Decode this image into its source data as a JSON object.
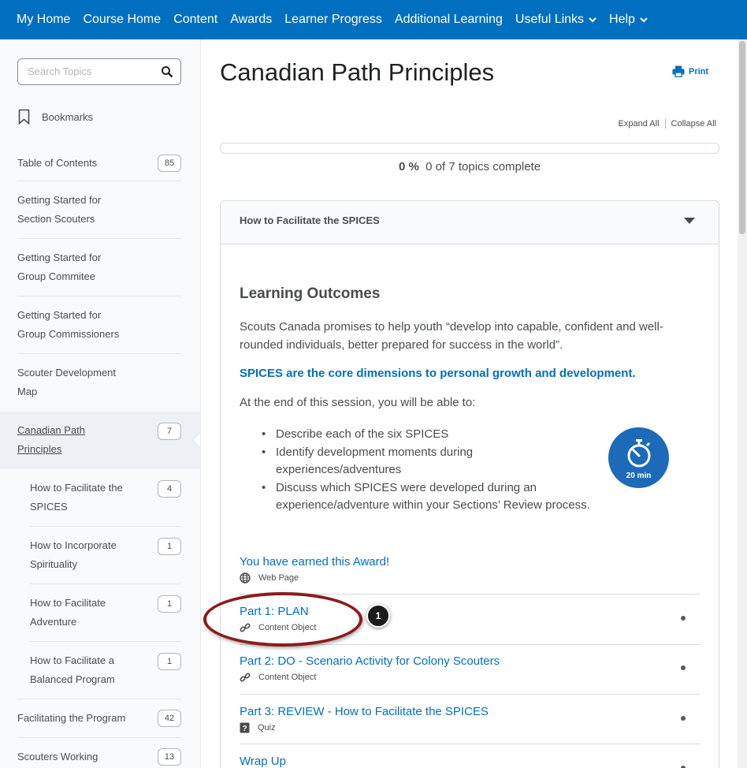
{
  "nav": {
    "items": [
      {
        "label": "My Home"
      },
      {
        "label": "Course Home"
      },
      {
        "label": "Content"
      },
      {
        "label": "Awards"
      },
      {
        "label": "Learner Progress"
      },
      {
        "label": "Additional Learning"
      },
      {
        "label": "Useful Links",
        "dropdown": true
      },
      {
        "label": "Help",
        "dropdown": true
      }
    ]
  },
  "sidebar": {
    "search_placeholder": "Search Topics",
    "bookmarks_label": "Bookmarks",
    "toc": [
      {
        "label": "Table of Contents",
        "count": "85"
      },
      {
        "label": "Getting Started for Section Scouters"
      },
      {
        "label": "Getting Started for Group Commitee"
      },
      {
        "label": "Getting Started for Group Commissioners"
      },
      {
        "label": "Scouter Development Map"
      },
      {
        "label": "Canadian Path Principles",
        "count": "7",
        "active": true
      },
      {
        "label": "How to Facilitate the SPICES",
        "count": "4",
        "sub": true
      },
      {
        "label": "How to Incorporate Spirituality",
        "count": "1",
        "sub": true
      },
      {
        "label": "How to Facilitate Adventure",
        "count": "1",
        "sub": true
      },
      {
        "label": "How to Facilitate a Balanced Program",
        "count": "1",
        "sub": true
      },
      {
        "label": "Facilitating the Program",
        "count": "42"
      },
      {
        "label": "Scouters Working",
        "count": "13"
      }
    ]
  },
  "main": {
    "title": "Canadian Path Principles",
    "print_label": "Print",
    "expand_all": "Expand All",
    "collapse_all": "Collapse All",
    "progress_pct": "0 %",
    "progress_text": "0 of 7 topics complete",
    "progress_fraction": 0
  },
  "module": {
    "title": "How to Facilitate the SPICES",
    "lo_heading": "Learning Outcomes",
    "lo_p1": "Scouts Canada promises to help youth “develop into capable, confident and well-rounded individuals, better prepared for success in the world”.",
    "lo_p2": "SPICES are the core dimensions to personal growth and development.",
    "lo_p3": "At the end of this session, you will be able to:",
    "lo_list": [
      "Describe each of the six SPICES",
      "Identify development moments during experiences/adventures",
      "Discuss which SPICES were developed during an experience/adventure within your Sections’ Review process."
    ],
    "timer_label": "20 min"
  },
  "topics": [
    {
      "title": "You have earned this Award!",
      "type": "Web Page",
      "icon": "globe-icon"
    },
    {
      "title": "Part 1: PLAN",
      "type": "Content Object",
      "icon": "link-icon"
    },
    {
      "title": "Part 2: DO - Scenario Activity for Colony Scouters",
      "type": "Content Object",
      "icon": "link-icon"
    },
    {
      "title": "Part 3: REVIEW - How to Facilitate the SPICES",
      "type": "Quiz",
      "icon": "quiz-icon"
    },
    {
      "title": "Wrap Up"
    }
  ],
  "callout_number": "1",
  "colors": {
    "nav_bg": "#006fbf",
    "link": "#006fbf",
    "annotation": "#8b1b1b",
    "timer_badge": "#1d6ab8"
  }
}
